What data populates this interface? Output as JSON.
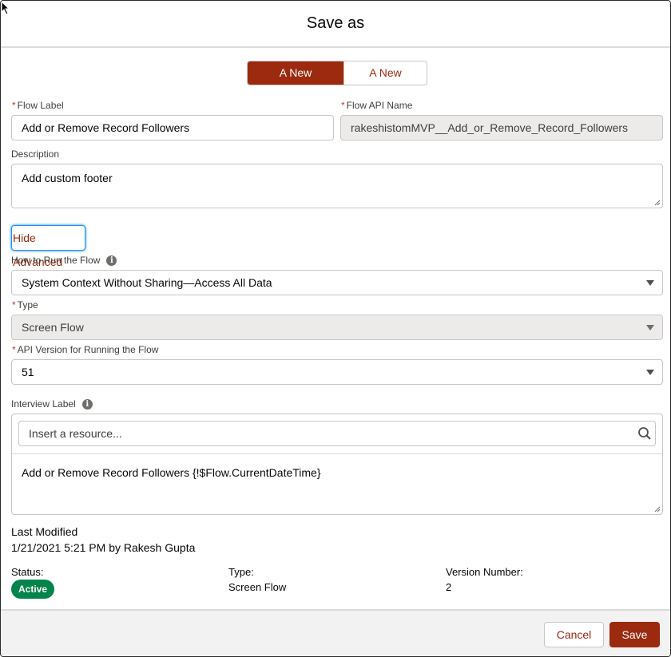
{
  "modal": {
    "title": "Save as"
  },
  "save_option": {
    "options": [
      "A New Version",
      "A New Flow"
    ],
    "selected": "A New Version"
  },
  "flow_label": {
    "label": "Flow Label",
    "required_marker": "*",
    "value": "Add or Remove Record Followers"
  },
  "flow_api_name": {
    "label": "Flow API Name",
    "required_marker": "*",
    "value": "rakeshistomMVP__Add_or_Remove_Record_Followers"
  },
  "description": {
    "label": "Description",
    "value": "Add custom footer"
  },
  "advanced_toggle": {
    "label": "Hide Advanced"
  },
  "how_to_run": {
    "label": "How to Run the Flow",
    "value": "System Context Without Sharing—Access All Data",
    "info_icon": "info-icon"
  },
  "type": {
    "label": "Type",
    "required_marker": "*",
    "value": "Screen Flow"
  },
  "api_version": {
    "label": "API Version for Running the Flow",
    "required_marker": "*",
    "value": "51"
  },
  "interview_label": {
    "label": "Interview Label",
    "info_icon": "info-icon",
    "resource_placeholder": "Insert a resource...",
    "search_icon": "search-icon",
    "value": "Add or Remove Record Followers {!$Flow.CurrentDateTime}"
  },
  "last_modified": {
    "label": "Last Modified",
    "value": "1/21/2021 5:21 PM by Rakesh Gupta"
  },
  "status": {
    "label": "Status:",
    "value": "Active",
    "color": "#04844b"
  },
  "flow_type": {
    "label": "Type:",
    "value": "Screen Flow"
  },
  "version_number": {
    "label": "Version Number:",
    "value": "2"
  },
  "footer": {
    "cancel_label": "Cancel",
    "save_label": "Save"
  },
  "colors": {
    "brand": "#9c2a0f",
    "active_badge": "#04844b",
    "required": "#c23934"
  }
}
